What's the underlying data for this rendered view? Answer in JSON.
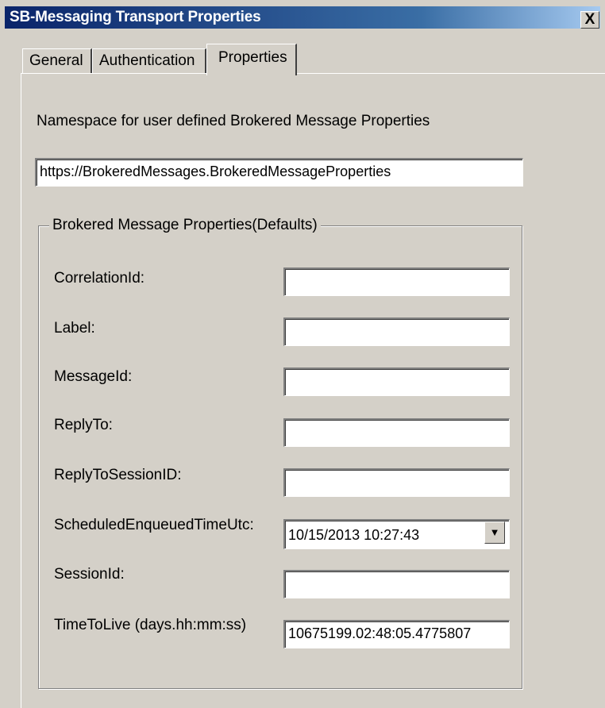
{
  "window": {
    "title": "SB-Messaging Transport Properties",
    "close_label": "X"
  },
  "tabs": [
    {
      "label": "General",
      "selected": false
    },
    {
      "label": "Authentication",
      "selected": false
    },
    {
      "label": "Properties",
      "selected": true
    }
  ],
  "namespace": {
    "label": "Namespace for user defined Brokered Message Properties",
    "value": "https://BrokeredMessages.BrokeredMessageProperties"
  },
  "group": {
    "title": "Brokered Message Properties(Defaults)",
    "fields": [
      {
        "label": "CorrelationId:",
        "value": ""
      },
      {
        "label": "Label:",
        "value": ""
      },
      {
        "label": "MessageId:",
        "value": ""
      },
      {
        "label": "ReplyTo:",
        "value": ""
      },
      {
        "label": "ReplyToSessionID:",
        "value": ""
      },
      {
        "label": "ScheduledEnqueuedTimeUtc:",
        "value": "10/15/2013 10:27:43",
        "dropdown_icon": "chevron-down-icon"
      },
      {
        "label": "SessionId:",
        "value": ""
      },
      {
        "label": "TimeToLive (days.hh:mm:ss)",
        "value": "10675199.02:48:05.4775807"
      }
    ]
  },
  "colors": {
    "titlebar_start": "#0a246a",
    "titlebar_end": "#a6caf0",
    "dialog_bg": "#d4d0c8"
  }
}
